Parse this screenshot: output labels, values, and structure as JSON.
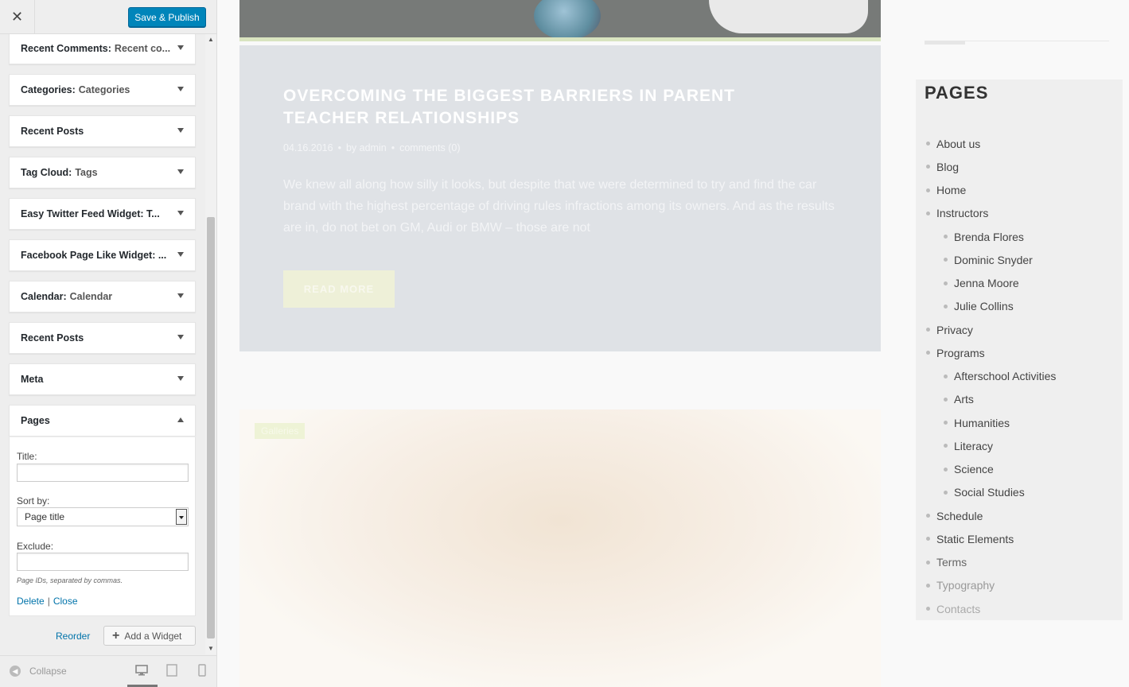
{
  "header": {
    "close_icon": "close-icon",
    "save_label": "Save & Publish"
  },
  "widgets": [
    {
      "name": "Recent Comments:",
      "title": "Recent co..."
    },
    {
      "name": "Categories:",
      "title": "Categories"
    },
    {
      "name": "Recent Posts",
      "title": ""
    },
    {
      "name": "Tag Cloud:",
      "title": "Tags"
    },
    {
      "name": "Easy Twitter Feed Widget: T...",
      "title": ""
    },
    {
      "name": "Facebook Page Like Widget: ...",
      "title": ""
    },
    {
      "name": "Calendar:",
      "title": "Calendar"
    },
    {
      "name": "Recent Posts",
      "title": ""
    },
    {
      "name": "Meta",
      "title": ""
    },
    {
      "name": "Pages",
      "title": ""
    }
  ],
  "pages_form": {
    "title_label": "Title:",
    "title_value": "",
    "sort_label": "Sort by:",
    "sort_value": "Page title",
    "exclude_label": "Exclude:",
    "exclude_value": "",
    "hint": "Page IDs, separated by commas.",
    "delete_label": "Delete",
    "close_label": "Close"
  },
  "actions": {
    "reorder_label": "Reorder",
    "add_widget_label": "Add a Widget"
  },
  "footer": {
    "collapse_label": "Collapse",
    "devices": [
      "desktop-icon",
      "tablet-icon",
      "mobile-icon"
    ]
  },
  "post": {
    "title": "OVERCOMING THE BIGGEST BARRIERS IN PARENT TEACHER RELATIONSHIPS",
    "date": "04.16.2016",
    "author": "by admin",
    "comments": "comments (0)",
    "excerpt": "We knew all along how silly it looks, but despite that we were determined to try and find the car brand with the highest percentage of driving rules infractions among its owners. And as the results are in, do not bet on GM, Audi or BMW – those are not",
    "read_more": "READ MORE",
    "next_badge": "Galleries"
  },
  "pages_widget": {
    "heading": "PAGES",
    "items": [
      {
        "label": "About us",
        "level": 0
      },
      {
        "label": "Blog",
        "level": 0
      },
      {
        "label": "Home",
        "level": 0
      },
      {
        "label": "Instructors",
        "level": 0
      },
      {
        "label": "Brenda Flores",
        "level": 1
      },
      {
        "label": "Dominic Snyder",
        "level": 1
      },
      {
        "label": "Jenna Moore",
        "level": 1
      },
      {
        "label": "Julie Collins",
        "level": 1
      },
      {
        "label": "Privacy",
        "level": 0
      },
      {
        "label": "Programs",
        "level": 0
      },
      {
        "label": "Afterschool Activities",
        "level": 1
      },
      {
        "label": "Arts",
        "level": 1
      },
      {
        "label": "Humanities",
        "level": 1
      },
      {
        "label": "Literacy",
        "level": 1
      },
      {
        "label": "Science",
        "level": 1
      },
      {
        "label": "Social Studies",
        "level": 1
      },
      {
        "label": "Schedule",
        "level": 0
      },
      {
        "label": "Static Elements",
        "level": 0
      },
      {
        "label": "Terms",
        "level": 0
      },
      {
        "label": "Typography",
        "level": 0
      },
      {
        "label": "Contacts",
        "level": 0
      }
    ]
  }
}
